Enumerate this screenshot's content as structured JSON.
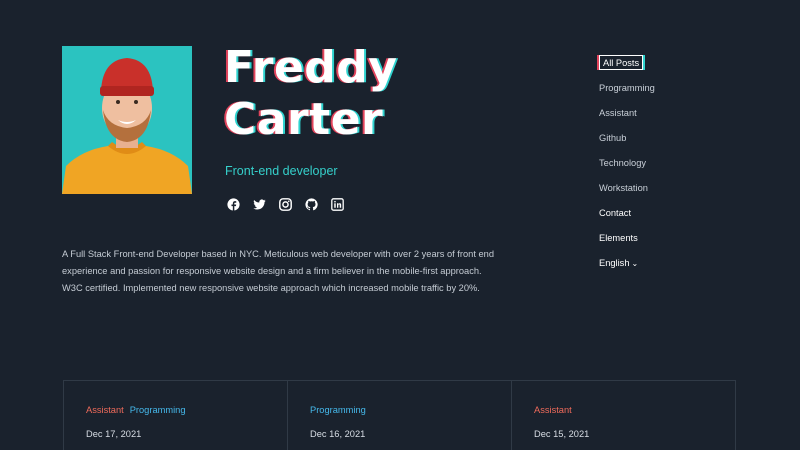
{
  "profile": {
    "first_name": "Freddy",
    "last_name": "Carter",
    "role": "Front-end developer",
    "bio": "A Full Stack Front-end Developer based in NYC. Meticulous web developer with over 2 years of front end experience and passion for responsive website design and a firm believer in the mobile-first approach. W3C certified. Implemented new responsive website approach which increased mobile traffic by 20%.",
    "socials": [
      "facebook-icon",
      "twitter-icon",
      "instagram-icon",
      "github-icon",
      "linkedin-icon"
    ]
  },
  "nav": {
    "items": [
      {
        "label": "All Posts"
      },
      {
        "label": "Programming"
      },
      {
        "label": "Assistant"
      },
      {
        "label": "Github"
      },
      {
        "label": "Technology"
      },
      {
        "label": "Workstation"
      },
      {
        "label": "Contact"
      },
      {
        "label": "Elements"
      },
      {
        "label": "English"
      }
    ]
  },
  "cards": [
    {
      "tags": [
        "Assistant",
        "Programming"
      ],
      "date": "Dec 17, 2021"
    },
    {
      "tags": [
        "Programming"
      ],
      "date": "Dec 16, 2021"
    },
    {
      "tags": [
        "Assistant"
      ],
      "date": "Dec 15, 2021"
    }
  ],
  "colors": {
    "background": "#1a222d",
    "accent_teal": "#35d0cb",
    "accent_red": "#e2445c",
    "tag_assistant": "#ef6b5b",
    "tag_programming": "#45b8ea"
  }
}
